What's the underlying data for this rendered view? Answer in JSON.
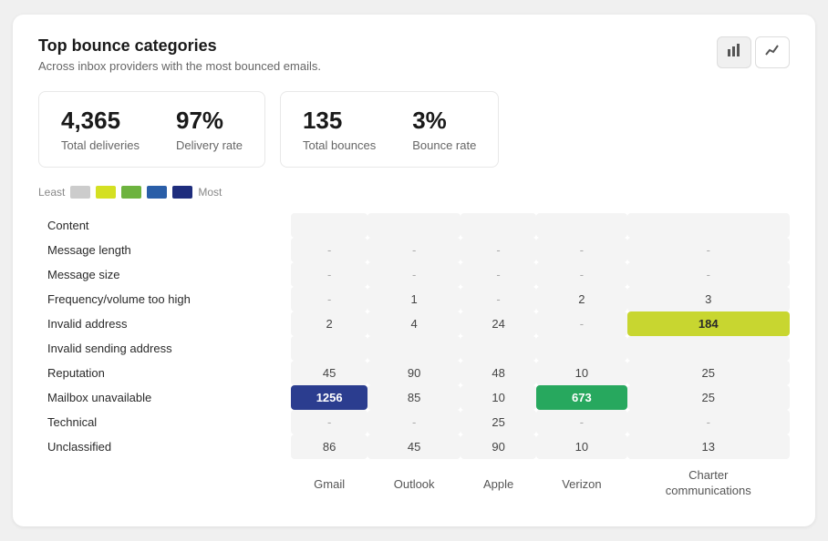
{
  "header": {
    "title": "Top bounce categories",
    "subtitle": "Across inbox providers with the most bounced emails."
  },
  "stats": {
    "left": [
      {
        "value": "4,365",
        "label": "Total deliveries"
      },
      {
        "value": "97%",
        "label": "Delivery rate"
      }
    ],
    "right": [
      {
        "value": "135",
        "label": "Total bounces"
      },
      {
        "value": "3%",
        "label": "Bounce rate"
      }
    ]
  },
  "legend": {
    "least_label": "Least",
    "most_label": "Most",
    "swatches": [
      "#ccc",
      "#d4e022",
      "#6db33f",
      "#2a5ea8",
      "#1e2d7d"
    ]
  },
  "table": {
    "columns": [
      "",
      "Gmail",
      "Outlook",
      "Apple",
      "Verizon",
      "Charter\ncommunications"
    ],
    "rows": [
      {
        "label": "Content",
        "cells": [
          "",
          "",
          "",
          "",
          ""
        ]
      },
      {
        "label": "Message length",
        "cells": [
          "-",
          "-",
          "-",
          "-",
          "-"
        ]
      },
      {
        "label": "Message size",
        "cells": [
          "-",
          "-",
          "-",
          "-",
          "-"
        ]
      },
      {
        "label": "Frequency/volume too high",
        "cells": [
          "-",
          "1",
          "-",
          "2",
          "3"
        ]
      },
      {
        "label": "Invalid address",
        "cells": [
          "2",
          "4",
          "24",
          "-",
          "184"
        ]
      },
      {
        "label": "Invalid sending address",
        "cells": [
          "",
          "",
          "",
          "",
          ""
        ]
      },
      {
        "label": "Reputation",
        "cells": [
          "45",
          "90",
          "48",
          "10",
          "25"
        ]
      },
      {
        "label": "Mailbox unavailable",
        "cells": [
          "1256",
          "85",
          "10",
          "673",
          "25"
        ]
      },
      {
        "label": "Technical",
        "cells": [
          "-",
          "-",
          "25",
          "-",
          "-"
        ]
      },
      {
        "label": "Unclassified",
        "cells": [
          "86",
          "45",
          "90",
          "10",
          "13"
        ]
      }
    ],
    "highlights": {
      "invalid_address_charter": "yellow",
      "mailbox_unavailable_gmail": "dark-blue",
      "mailbox_unavailable_verizon": "green"
    }
  },
  "buttons": {
    "bar_chart": "▐▌",
    "line_chart": "↗"
  }
}
